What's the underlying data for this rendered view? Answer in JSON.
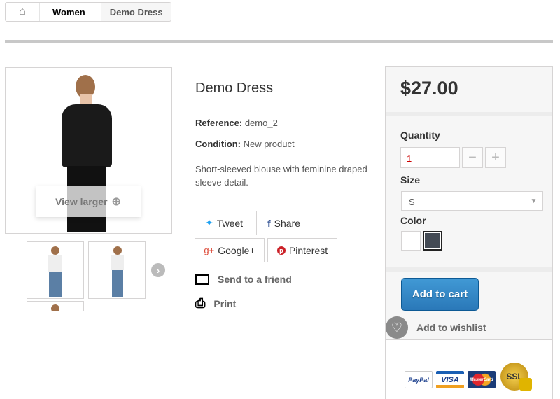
{
  "breadcrumb": {
    "items": [
      "Women",
      "Demo Dress"
    ]
  },
  "gallery": {
    "view_larger": "View larger"
  },
  "product": {
    "title": "Demo Dress",
    "reference_label": "Reference:",
    "reference": "demo_2",
    "condition_label": "Condition:",
    "condition": "New product",
    "description": "Short-sleeved blouse with feminine draped sleeve detail."
  },
  "social": [
    {
      "label": "Tweet",
      "icon": "twitter-icon"
    },
    {
      "label": "Share",
      "icon": "facebook-icon"
    },
    {
      "label": "Google+",
      "icon": "google-plus-icon"
    },
    {
      "label": "Pinterest",
      "icon": "pinterest-icon"
    }
  ],
  "links": {
    "send": "Send to a friend",
    "print": "Print"
  },
  "buy": {
    "price": "$27.00",
    "quantity_label": "Quantity",
    "quantity": "1",
    "size_label": "Size",
    "size": "S",
    "color_label": "Color",
    "colors": [
      "#ffffff",
      "#434a54"
    ],
    "add_to_cart": "Add to cart",
    "wishlist": "Add to wishlist"
  },
  "payment": {
    "cards": [
      "PayPal",
      "VISA",
      "MasterCard",
      "SSL"
    ]
  },
  "colors": {
    "accent": "#2a78b8"
  }
}
